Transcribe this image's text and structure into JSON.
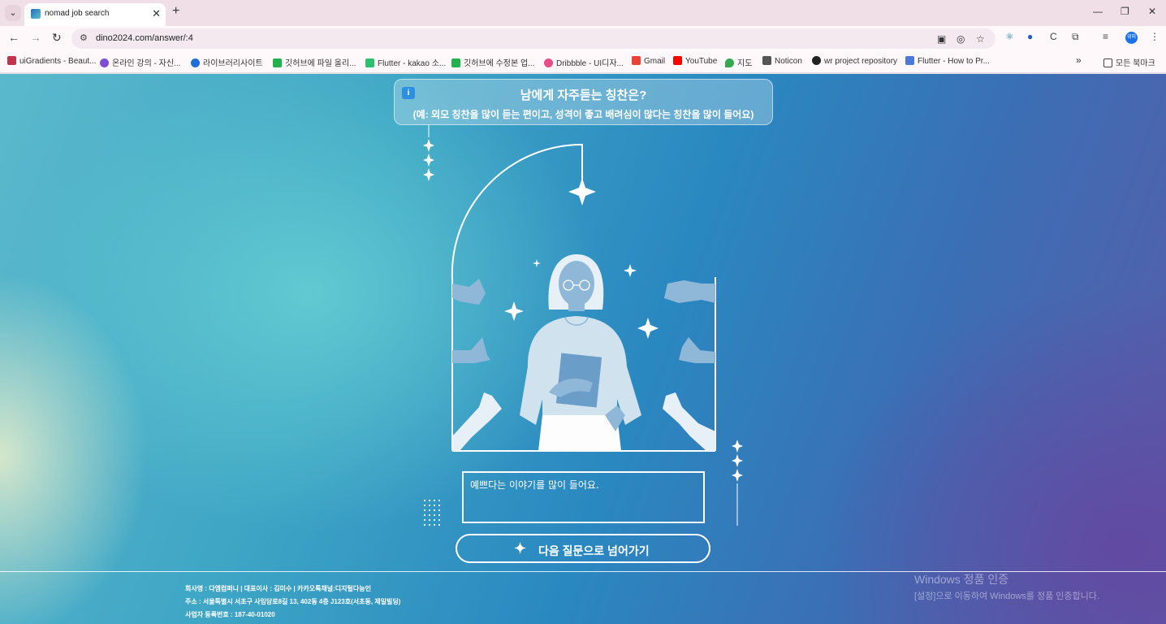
{
  "browser": {
    "tab_title": "nomad job search",
    "url": "dino2024.com/answer/:4",
    "profile_initials": "위피"
  },
  "bookmarks": [
    {
      "label": "uiGradients - Beaut...",
      "color": "#c2334d"
    },
    {
      "label": "온라인 강의 - 자신...",
      "color": "#7c4bd9"
    },
    {
      "label": "라이브러리사이트",
      "color": "#1e6fd9"
    },
    {
      "label": "깃허브에 파일 올리...",
      "color": "#22b14c"
    },
    {
      "label": "Flutter - kakao 소...",
      "color": "#2fbf71"
    },
    {
      "label": "깃허브에 수정본 업...",
      "color": "#22b14c"
    },
    {
      "label": "Dribbble - UI디자...",
      "color": "#ea4c89"
    },
    {
      "label": "Gmail",
      "color": "#ea4335"
    },
    {
      "label": "YouTube",
      "color": "#ff0000"
    },
    {
      "label": "지도",
      "color": "#34a853"
    },
    {
      "label": "Noticon",
      "color": "#555555"
    },
    {
      "label": "wr project repository",
      "color": "#222222"
    },
    {
      "label": "Flutter - How to Pr...",
      "color": "#4a7bd9"
    }
  ],
  "bookmarks_folder": "모든 북마크",
  "question": {
    "title": "남에게 자주듣는 칭찬은?",
    "subtitle": "(예: 외모 칭찬을 많이 듣는 편이고, 성격이 좋고 배려심이 많다는 칭찬을 많이 들어요)"
  },
  "answer": {
    "value": "예쁘다는 이야기를 많이 들어요."
  },
  "next_button": {
    "label": "다음 질문으로 넘어가기"
  },
  "footer": {
    "line1": "회사명 : 다엠컴퍼니 | 대표이사 : 김미수 | 카카오톡채널:디지털다능인",
    "line2": "주소 : 서울특별시 서초구 사임당로8길 13, 402동 4층 J123호(서초동, 제일빌딩)",
    "line3": "사업자 등록번호 : 187-40-01020"
  },
  "watermark": {
    "line1": "Windows 정품 인증",
    "line2": "[설정]으로 이동하여 Windows를 정품 인증합니다."
  }
}
